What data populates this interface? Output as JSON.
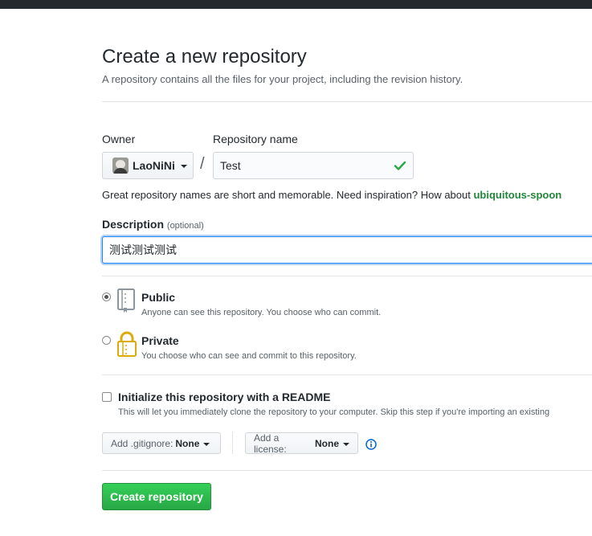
{
  "header": {
    "title": "Create a new repository",
    "subtitle": "A repository contains all the files for your project, including the revision history."
  },
  "owner": {
    "label": "Owner",
    "value": "LaoNiNi",
    "avatar_icon": "user-avatar"
  },
  "separator": "/",
  "repo_name": {
    "label": "Repository name",
    "value": "Test",
    "status_icon": "check-icon",
    "status_color": "#28a745"
  },
  "hint": {
    "text": "Great repository names are short and memorable. Need inspiration? How about ",
    "suggestion": "ubiquitous-spoon"
  },
  "description": {
    "label": "Description",
    "optional": "(optional)",
    "value": "测试测试测试"
  },
  "visibility": {
    "selected": "public",
    "public": {
      "title": "Public",
      "note": "Anyone can see this repository. You choose who can commit.",
      "icon": "repo-book-icon"
    },
    "private": {
      "title": "Private",
      "note": "You choose who can see and commit to this repository.",
      "icon": "lock-icon"
    }
  },
  "readme": {
    "checked": false,
    "label": "Initialize this repository with a README",
    "note": "This will let you immediately clone the repository to your computer. Skip this step if you're importing an existing"
  },
  "gitignore": {
    "label": "Add .gitignore:",
    "value": "None"
  },
  "license": {
    "label": "Add a license:",
    "value": "None",
    "info_icon": "info-icon"
  },
  "submit": {
    "label": "Create repository",
    "color": "#28a745"
  }
}
